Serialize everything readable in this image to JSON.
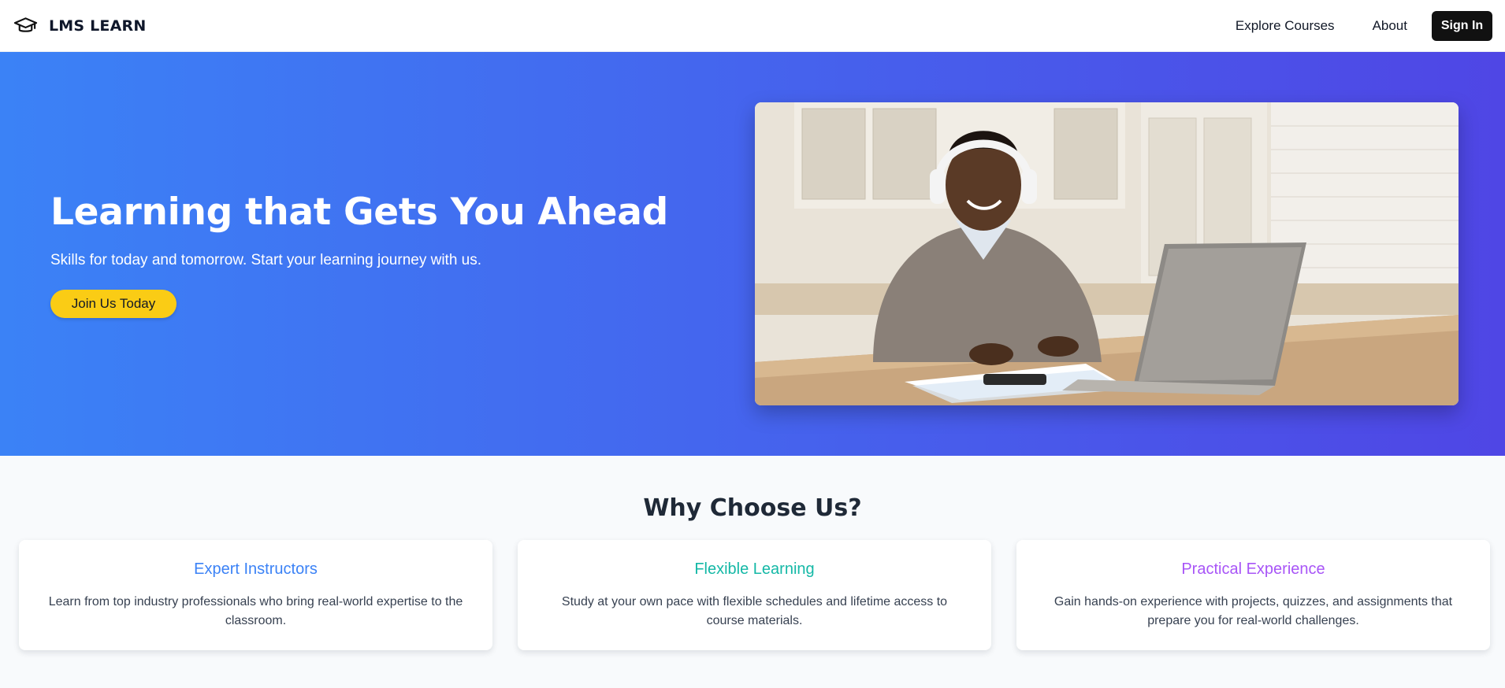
{
  "brand": {
    "name": "LMS LEARN",
    "icon": "graduation-cap-icon"
  },
  "nav": {
    "links": [
      {
        "label": "Explore Courses"
      },
      {
        "label": "About"
      }
    ],
    "signin_label": "Sign In"
  },
  "hero": {
    "title": "Learning that Gets You Ahead",
    "subtitle": "Skills for today and tomorrow. Start your learning journey with us.",
    "cta_label": "Join Us Today",
    "image_icon": "student-with-laptop-photo",
    "colors": {
      "gradient_start": "#3b82f6",
      "gradient_end": "#4f46e5",
      "cta_background": "#facc15"
    }
  },
  "why": {
    "title": "Why Choose Us?",
    "features": [
      {
        "title": "Expert Instructors",
        "description": "Learn from top industry professionals who bring real-world expertise to the classroom.",
        "color": "#3b82f6"
      },
      {
        "title": "Flexible Learning",
        "description": "Study at your own pace with flexible schedules and lifetime access to course materials.",
        "color": "#14b8a6"
      },
      {
        "title": "Practical Experience",
        "description": "Gain hands-on experience with projects, quizzes, and assignments that prepare you for real-world challenges.",
        "color": "#a855f7"
      }
    ]
  }
}
